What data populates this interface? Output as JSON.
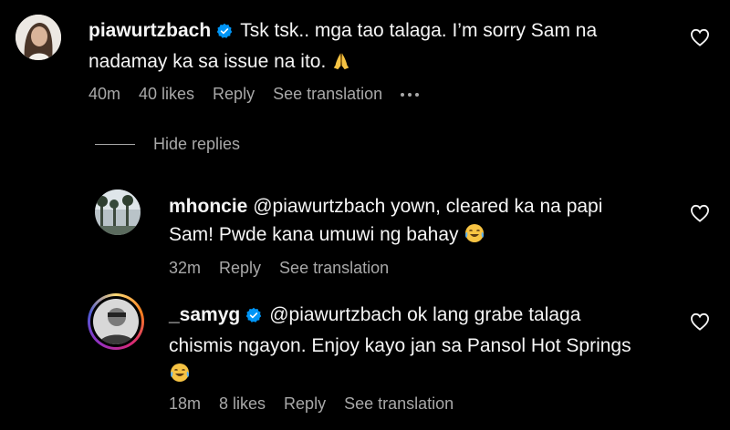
{
  "comments": [
    {
      "username": "piawurtzbach",
      "text_line1": "Tsk tsk.. mga tao talaga. I’m sorry Sam na",
      "text_line2": "nadamay ka sa issue na ito.",
      "emoji": "folded-hands",
      "time": "40m",
      "likes": "40 likes",
      "reply": "Reply",
      "translation": "See translation",
      "verified": true
    },
    {
      "username": "mhoncie",
      "text_line1": "@piawurtzbach yown, cleared ka na papi",
      "text_line2": "Sam! Pwde kana umuwi ng bahay",
      "emoji": "tears-of-joy",
      "time": "32m",
      "reply": "Reply",
      "translation": "See translation",
      "verified": false
    },
    {
      "username": "_samyg",
      "text_line1": "@piawurtzbach ok lang grabe talaga",
      "text_line2": "chismis ngayon. Enjoy kayo jan sa Pansol Hot Springs",
      "emoji": "tears-of-joy",
      "time": "18m",
      "likes": "8 likes",
      "reply": "Reply",
      "translation": "See translation",
      "verified": true
    }
  ],
  "hide_replies": "Hide replies",
  "colors": {
    "background": "#000000",
    "text": "#f5f5f5",
    "meta": "#a8a8a8",
    "verified": "#0095f6"
  }
}
